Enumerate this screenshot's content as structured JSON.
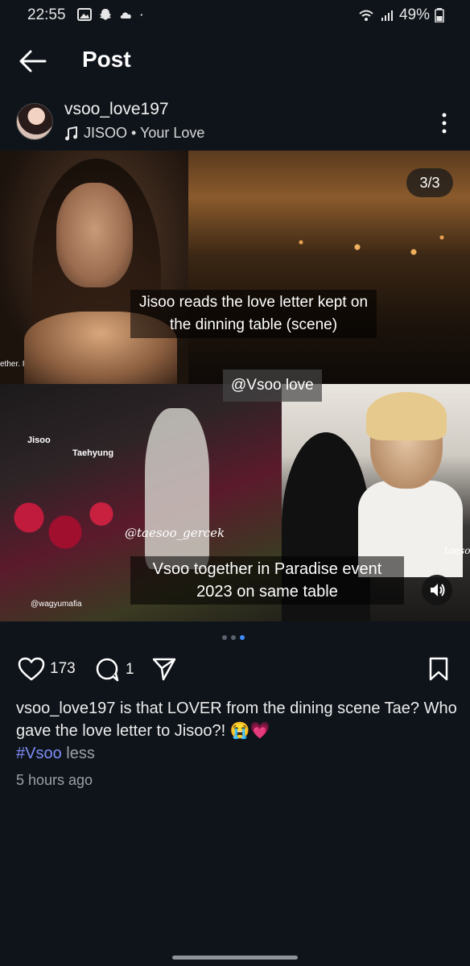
{
  "status_bar": {
    "time": "22:55",
    "battery": "49%",
    "icons_left": [
      "gallery-icon",
      "snapchat-icon",
      "cloud-icon",
      "dot-icon"
    ],
    "icons_right": [
      "wifi-icon",
      "signal-icon",
      "battery-icon"
    ]
  },
  "header": {
    "title": "Post",
    "back_icon": "arrow-left-icon"
  },
  "post": {
    "username": "vsoo_love197",
    "music": "JISOO • Your Love",
    "media": {
      "counter": "3/3",
      "caption_top": "Jisoo reads the love letter kept on the dinning table (scene)",
      "mention": "@Vsoo love",
      "caption_bottom": "Vsoo together in Paradise event 2023 on same table",
      "overlay_left_text": "ether. I",
      "label_jisoo": "Jisoo",
      "label_taehyung": "Taehyung",
      "watermark_taesoo": "@taesoo_gercek",
      "watermark_wagyu": "@wagyumafia",
      "watermark_right": "taesoo"
    },
    "carousel": {
      "count": 3,
      "active": 2
    },
    "likes": "173",
    "comments": "1",
    "caption_user": "vsoo_love197",
    "caption_text": " is that LOVER from the dining scene Tae? Who gave the love letter to Jisoo?! 😭💗",
    "hashtag": "#Vsoo",
    "less": "less",
    "time": "5 hours ago"
  },
  "colors": {
    "background": "#0f141a",
    "accent": "#3f8cf5",
    "hashtag": "#7d8cf5"
  }
}
